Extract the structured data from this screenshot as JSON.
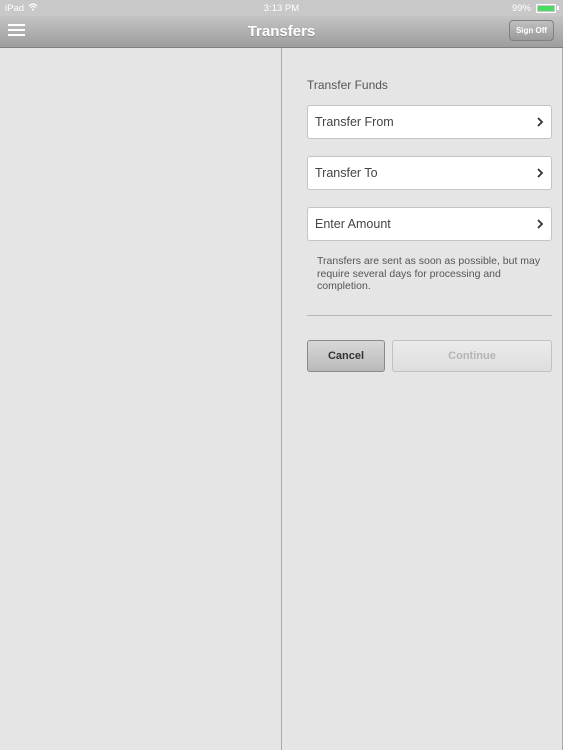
{
  "status": {
    "carrier": "iPad",
    "wifi_icon": "wifi-icon",
    "time": "3:13 PM",
    "battery": "99%",
    "battery_level": 0.99,
    "battery_color": "#4cd964"
  },
  "nav": {
    "menu_icon": "hamburger-menu-icon",
    "title": "Transfers",
    "signoff_label": "Sign Off"
  },
  "form": {
    "section_title": "Transfer Funds",
    "rows": [
      {
        "label": "Transfer From",
        "icon": "chevron-right-icon"
      },
      {
        "label": "Transfer To",
        "icon": "chevron-right-icon"
      },
      {
        "label": "Enter Amount",
        "icon": "chevron-right-icon"
      }
    ],
    "note": "Transfers are sent as soon as possible, but may require several days for processing and completion.",
    "cancel_label": "Cancel",
    "continue_label": "Continue"
  }
}
